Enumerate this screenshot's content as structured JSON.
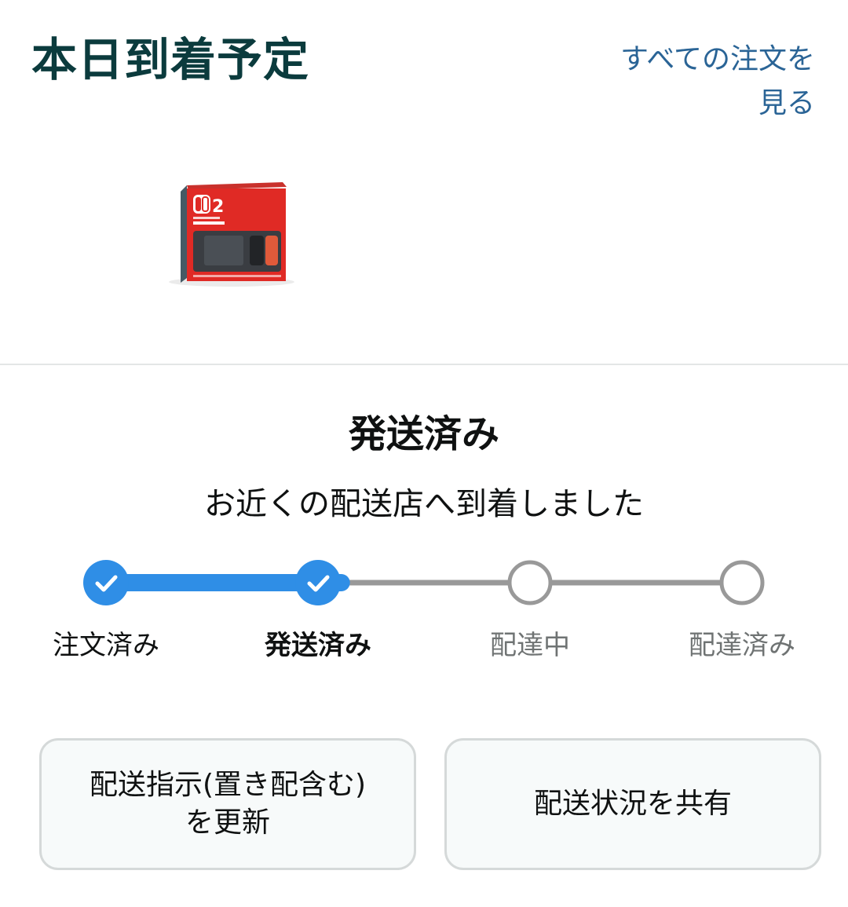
{
  "header": {
    "title": "本日到着予定",
    "all_orders_line1": "すべての注文を",
    "all_orders_line2": "見る"
  },
  "product": {
    "image_icon": "product-box-image",
    "box_text": "2"
  },
  "status": {
    "title": "発送済み",
    "detail": "お近くの配送店へ到着しました"
  },
  "tracker": {
    "progress_fraction": 0.37,
    "active_color": "#2f8ee6",
    "inactive_color": "#999999",
    "steps": [
      {
        "label": "注文済み",
        "state": "done"
      },
      {
        "label": "発送済み",
        "state": "current"
      },
      {
        "label": "配達中",
        "state": "pending"
      },
      {
        "label": "配達済み",
        "state": "pending"
      }
    ]
  },
  "actions": {
    "update_line1": "配送指示(置き配含む)",
    "update_line2": "を更新",
    "share_label": "配送状況を共有"
  },
  "colors": {
    "title": "#0b3b3d",
    "link": "#2a6496",
    "button_border": "#d5d9d9",
    "button_bg": "#f7fafa"
  }
}
